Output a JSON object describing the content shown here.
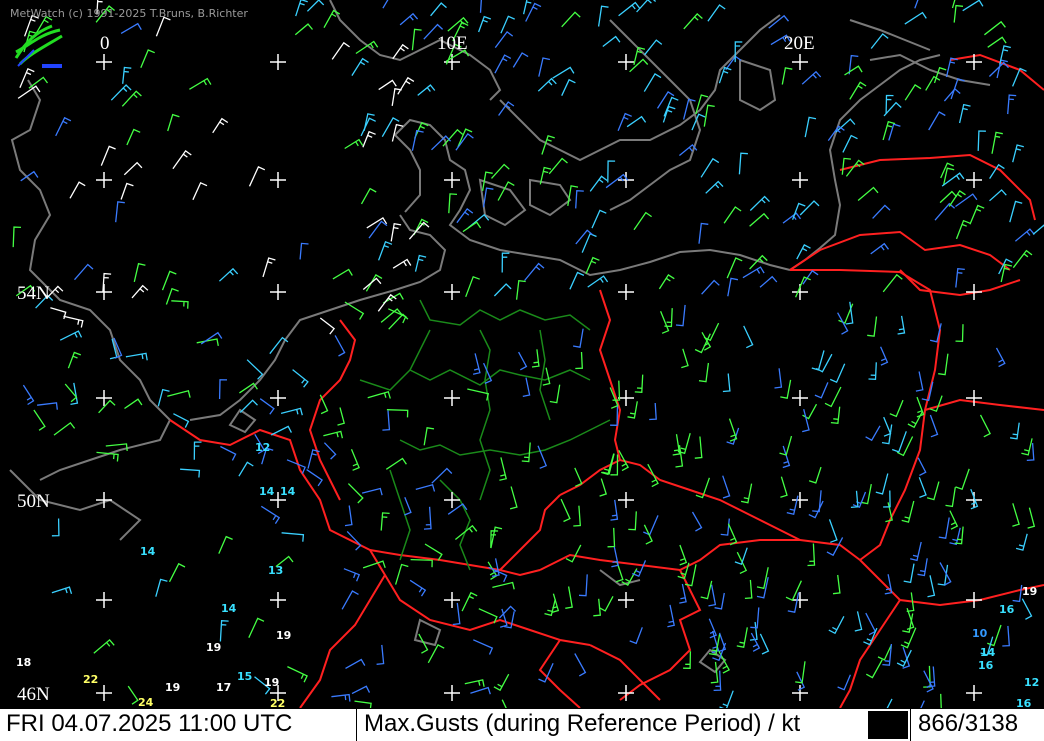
{
  "header": {
    "copyright": "MetWatch  (c) 1991-2025 T.Bruns, B.Richter"
  },
  "grid_labels": {
    "lon_0": "0",
    "lon_10e": "10E",
    "lon_20e": "20E",
    "lat_54n": "54N",
    "lat_50n": "50N",
    "lat_46n": "46N"
  },
  "observations": [
    {
      "id": "o1",
      "value": "12",
      "color": "#38e0ff"
    },
    {
      "id": "o2",
      "value": "14",
      "color": "#38e0ff"
    },
    {
      "id": "o3",
      "value": "14",
      "color": "#38e0ff"
    },
    {
      "id": "o4",
      "value": "14",
      "color": "#38e0ff"
    },
    {
      "id": "o5",
      "value": "13",
      "color": "#38e0ff"
    },
    {
      "id": "o6",
      "value": "14",
      "color": "#38e0ff"
    },
    {
      "id": "o7",
      "value": "19",
      "color": "#ffffff"
    },
    {
      "id": "o8",
      "value": "19",
      "color": "#ffffff"
    },
    {
      "id": "o9",
      "value": "18",
      "color": "#ffffff"
    },
    {
      "id": "o10",
      "value": "22",
      "color": "#ffff66"
    },
    {
      "id": "o11",
      "value": "24",
      "color": "#ffff66"
    },
    {
      "id": "o12",
      "value": "19",
      "color": "#ffffff"
    },
    {
      "id": "o13",
      "value": "15",
      "color": "#38e0ff"
    },
    {
      "id": "o14",
      "value": "17",
      "color": "#ffffff"
    },
    {
      "id": "o15",
      "value": "19",
      "color": "#ffffff"
    },
    {
      "id": "o16",
      "value": "22",
      "color": "#ffff66"
    },
    {
      "id": "o17",
      "value": "19",
      "color": "#ffffff"
    },
    {
      "id": "o18",
      "value": "16",
      "color": "#38e0ff"
    },
    {
      "id": "o19",
      "value": "10",
      "color": "#3399ff"
    },
    {
      "id": "o20",
      "value": "14",
      "color": "#38e0ff"
    },
    {
      "id": "o21",
      "value": "16",
      "color": "#38e0ff"
    },
    {
      "id": "o22",
      "value": "12",
      "color": "#38e0ff"
    },
    {
      "id": "o23",
      "value": "16",
      "color": "#38e0ff"
    }
  ],
  "status_bar": {
    "datetime": "FRI 04.07.2025 11:00 UTC",
    "parameter": "Max.Gusts (during Reference Period) / kt",
    "count": "866/3138"
  },
  "colors": {
    "background": "#000000",
    "coastline": "#808080",
    "country_border": "#ff2020",
    "german_states": "#1a8a1a",
    "wind_colors": [
      "#3a7bff",
      "#3ad0ff",
      "#44ff44",
      "#ffffff",
      "#2060ff"
    ]
  }
}
